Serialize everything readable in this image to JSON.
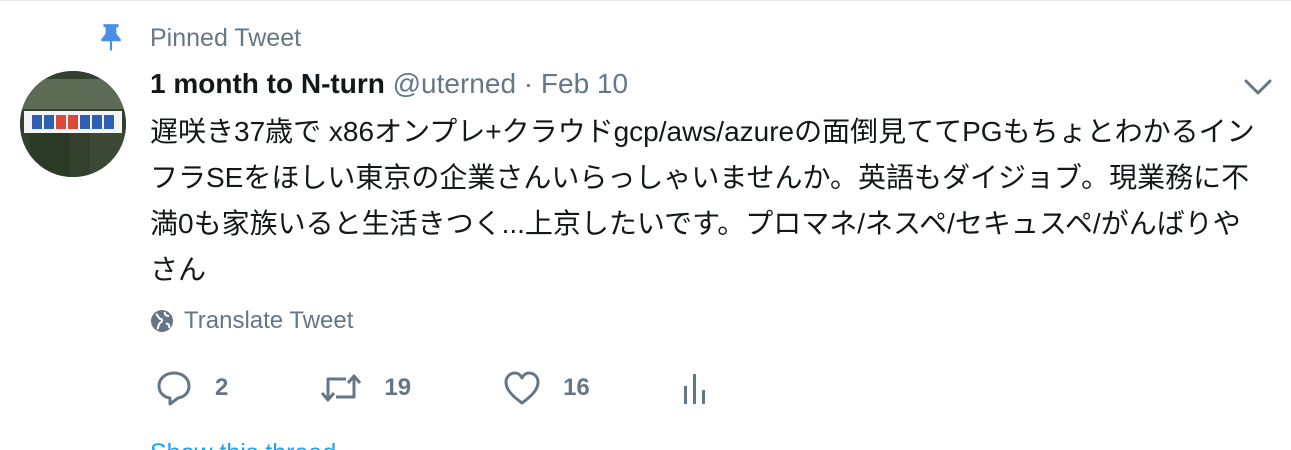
{
  "pinned": {
    "label": "Pinned Tweet",
    "icon": "pin-icon"
  },
  "tweet": {
    "fullname": "1 month to N-turn",
    "username": "@uterned",
    "separator": "·",
    "timestamp": "Feb 10",
    "text": "遅咲き37歳で x86オンプレ+クラウドgcp/aws/azureの面倒見ててPGもちょとわかるインフラSEをほしい東京の企業さんいらっしゃいませんか。英語もダイジョブ。現業務に不満0も家族いると生活きつく...上京したいです。プロマネ/ネスペ/セキュスペ/がんばりやさん",
    "translate_label": "Translate Tweet"
  },
  "actions": {
    "reply_count": "2",
    "retweet_count": "19",
    "like_count": "16"
  },
  "show_thread": "Show this thread",
  "colors": {
    "accent": "#1da1f2",
    "muted": "#657786",
    "text": "#14171a"
  }
}
